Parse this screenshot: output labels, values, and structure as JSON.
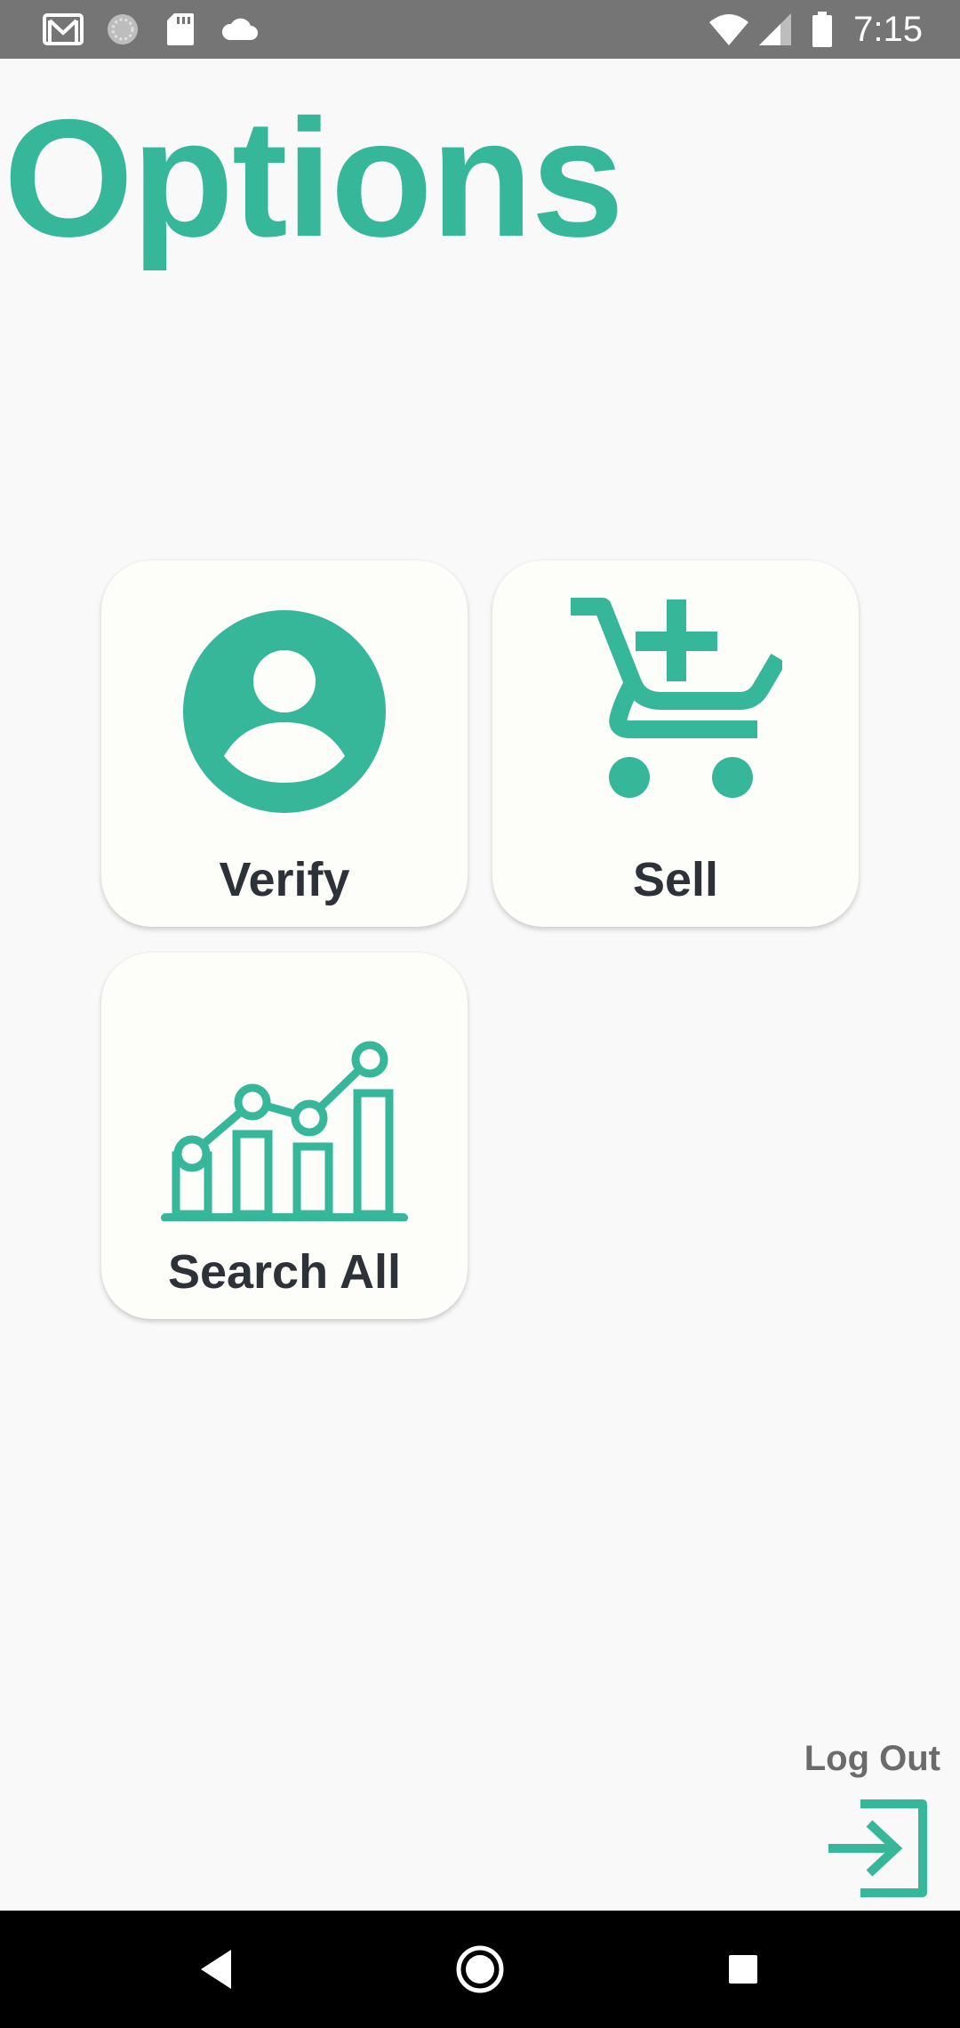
{
  "status_bar": {
    "time": "7:15",
    "left_icons": [
      "gmail-icon",
      "sync-icon",
      "sd-card-icon",
      "cloud-icon"
    ],
    "right_icons": [
      "wifi-icon",
      "signal-icon",
      "battery-icon"
    ]
  },
  "page": {
    "title": "Options"
  },
  "tiles": [
    {
      "label": "Verify",
      "icon": "user-account-icon"
    },
    {
      "label": "Sell",
      "icon": "cart-add-icon"
    },
    {
      "label": "Search All",
      "icon": "analytics-chart-icon"
    }
  ],
  "logout": {
    "label": "Log Out",
    "icon": "logout-icon"
  },
  "nav_bar": {
    "buttons": [
      "back-icon",
      "home-icon",
      "recents-icon"
    ]
  },
  "colors": {
    "accent": "#37b79a",
    "tile_background": "#fdfdf9",
    "label_text": "#2d3138",
    "status_bar": "#757575",
    "background": "#f9f9f9"
  }
}
